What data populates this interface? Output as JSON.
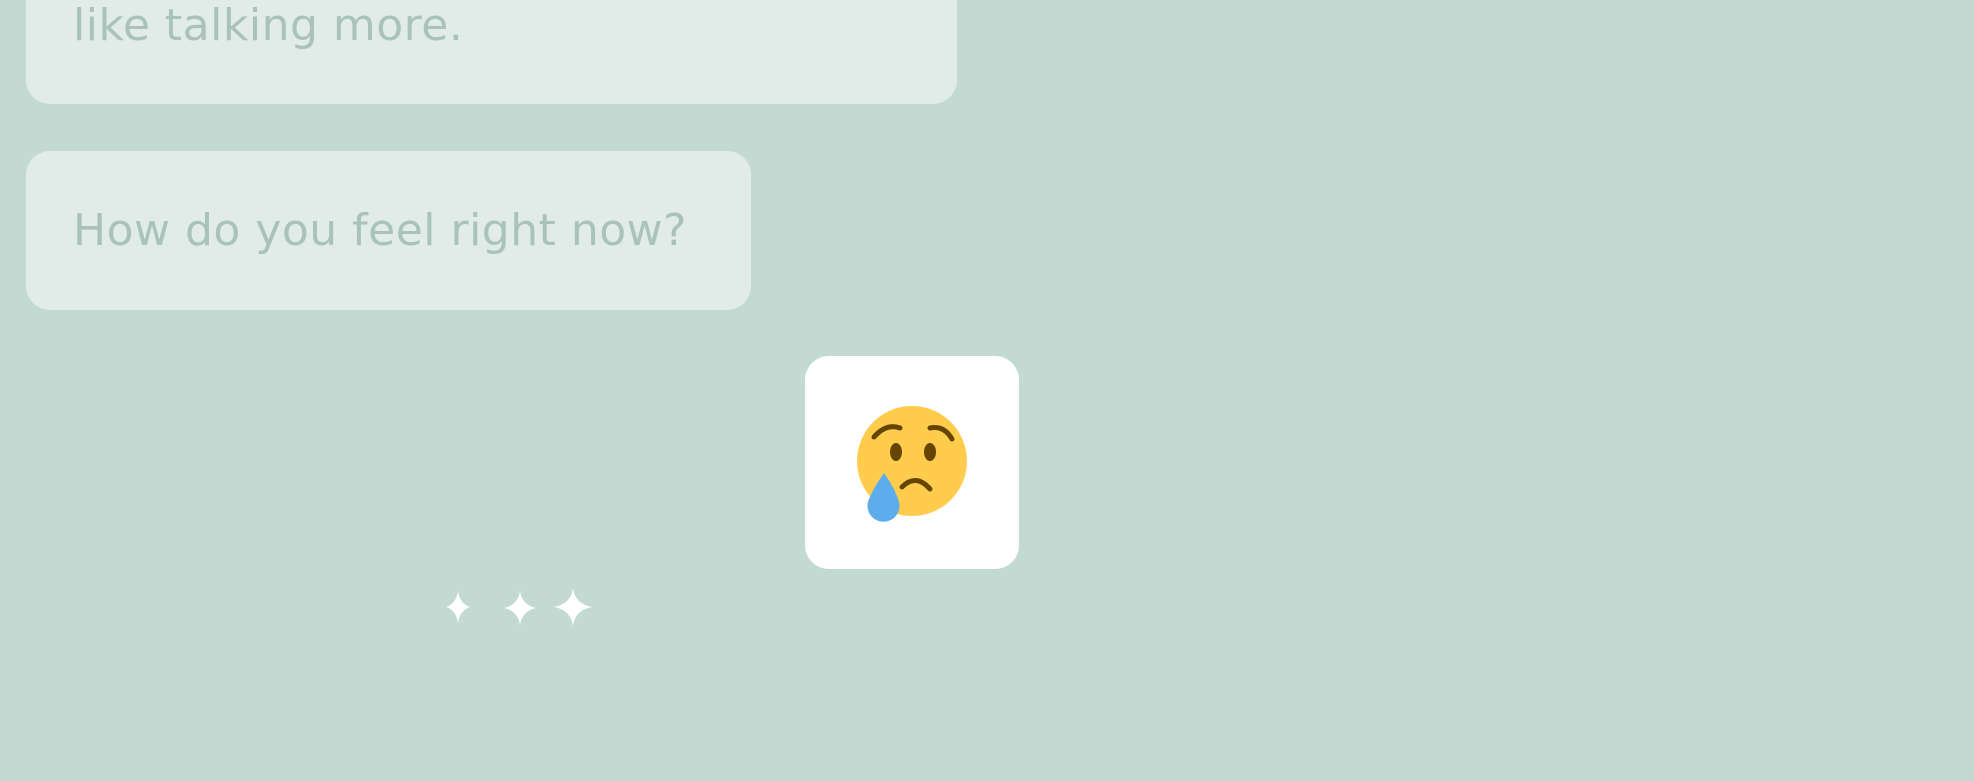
{
  "chat": {
    "messages": [
      {
        "text": "like talking more."
      },
      {
        "text": "How do you feel right now?"
      }
    ]
  },
  "mood_picker": {
    "selected": {
      "icon": "crying-face-icon"
    }
  },
  "typing_indicator": {
    "icon": "sparkles-icon"
  },
  "colors": {
    "background": "#c3dad2",
    "bubble": "#e1ece8",
    "bubble_text": "#a9c2ba",
    "card": "#ffffff",
    "emoji_face": "#ffcc4d",
    "emoji_tear": "#5dadec"
  }
}
